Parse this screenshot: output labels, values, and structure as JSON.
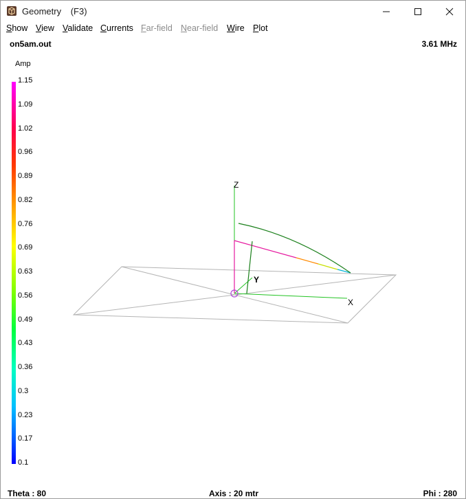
{
  "window": {
    "title": "Geometry",
    "shortcut": "(F3)"
  },
  "menu": [
    {
      "label": "Show",
      "disabled": false
    },
    {
      "label": "View",
      "disabled": false
    },
    {
      "label": "Validate",
      "disabled": false
    },
    {
      "label": "Currents",
      "disabled": false
    },
    {
      "label": "Far-field",
      "disabled": true
    },
    {
      "label": "Near-field",
      "disabled": true
    },
    {
      "label": "Wire",
      "disabled": false
    },
    {
      "label": "Plot",
      "disabled": false
    }
  ],
  "header": {
    "filename": "on5am.out",
    "frequency": "3.61 MHz"
  },
  "colorbar": {
    "label": "Amp",
    "ticks": [
      "1.15",
      "1.09",
      "1.02",
      "0.96",
      "0.89",
      "0.82",
      "0.76",
      "0.69",
      "0.63",
      "0.56",
      "0.49",
      "0.43",
      "0.36",
      "0.3",
      "0.23",
      "0.17",
      "0.1"
    ]
  },
  "axes": {
    "z": "Z",
    "y": "Y",
    "x": "X"
  },
  "footer": {
    "theta": "Theta : 80",
    "axis": "Axis : 20 mtr",
    "phi": "Phi : 280"
  },
  "colors": {
    "grid": "#b4b4b4",
    "axis_green": "#22c322",
    "wire_green": "#1a7f1a",
    "wire_magenta": "#e6199f"
  }
}
